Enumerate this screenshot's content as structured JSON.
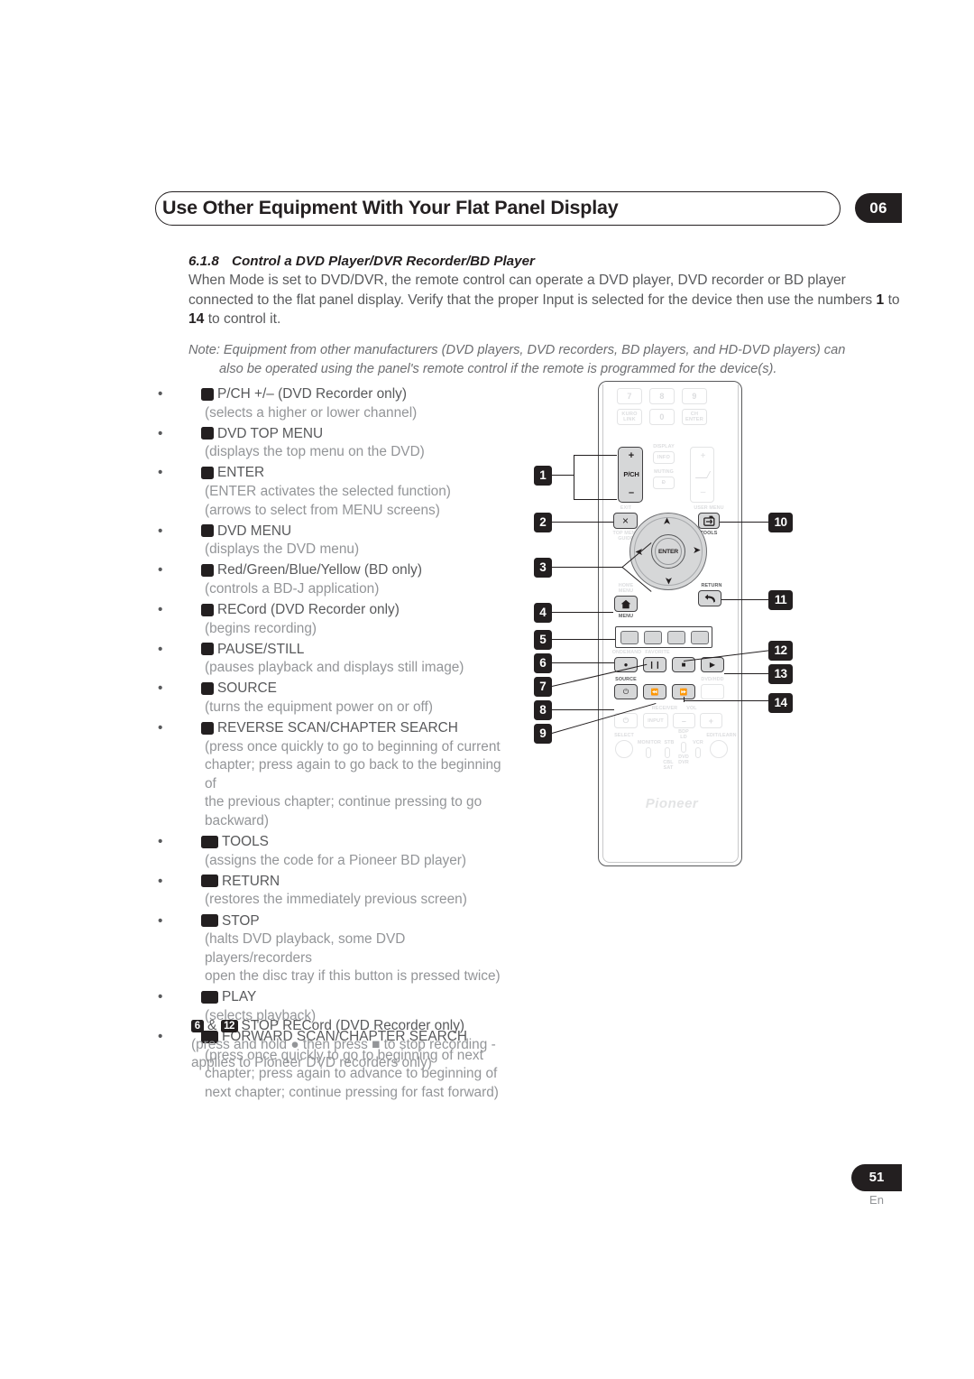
{
  "header": {
    "title": "Use Other Equipment With Your Flat Panel Display",
    "chapter_badge": "06"
  },
  "section": {
    "number": "6.1.8",
    "title": "Control a DVD Player/DVR Recorder/BD Player",
    "intro_part1": "When Mode is set to DVD/DVR, the remote control can operate a DVD player, DVD recorder or BD player connected to the flat panel display. Verify that the proper Input is selected for the device then use the numbers ",
    "intro_bold1": "1",
    "intro_part2": " to ",
    "intro_bold2": "14",
    "intro_part3": " to control it.",
    "note_line1": "Note: Equipment from other manufacturers (DVD players, DVD recorders, BD players, and HD-DVD players) can",
    "note_line2": "also be operated using the panel's remote control if the remote is programmed for the device(s)."
  },
  "items": [
    {
      "num": "1",
      "label": "P/CH +/– (DVD Recorder only)",
      "sub": [
        "(selects a higher or lower channel)"
      ]
    },
    {
      "num": "2",
      "label": "DVD TOP MENU",
      "sub": [
        "(displays the top menu on the DVD)"
      ]
    },
    {
      "num": "3",
      "label": "ENTER",
      "sub": [
        "(ENTER activates the selected function)",
        "(arrows to select from MENU screens)"
      ]
    },
    {
      "num": "4",
      "label": "DVD MENU",
      "sub": [
        "(displays the DVD menu)"
      ]
    },
    {
      "num": "5",
      "label": "Red/Green/Blue/Yellow (BD only)",
      "sub": [
        "(controls a BD-J application)"
      ]
    },
    {
      "num": "6",
      "label": "RECord (DVD Recorder only)",
      "sub": [
        "(begins recording)"
      ]
    },
    {
      "num": "7",
      "label": "PAUSE/STILL",
      "sub": [
        "(pauses playback and displays still image)"
      ]
    },
    {
      "num": "8",
      "label": "SOURCE",
      "sub": [
        "(turns the equipment power on or off)"
      ]
    },
    {
      "num": "9",
      "label": "REVERSE SCAN/CHAPTER SEARCH",
      "sub": [
        "(press once quickly to go to beginning of current",
        "chapter; press again to go back to the beginning of",
        "the previous chapter; continue pressing to go",
        "backward)"
      ]
    },
    {
      "num": "10",
      "label": "TOOLS",
      "sub": [
        "(assigns the code for a Pioneer BD player)"
      ]
    },
    {
      "num": "11",
      "label": "RETURN",
      "sub": [
        "(restores the immediately previous screen)"
      ]
    },
    {
      "num": "12",
      "label": "STOP",
      "sub": [
        "(halts DVD playback, some DVD players/recorders",
        "open the disc tray if this button is pressed twice)"
      ]
    },
    {
      "num": "13",
      "label": "PLAY",
      "sub": [
        "(selects playback)"
      ]
    },
    {
      "num": "14",
      "label": "FORWARD SCAN/CHAPTER SEARCH",
      "sub": [
        "(press once quickly to go to beginning of next",
        "chapter; press again to advance to beginning of",
        "next chapter; continue pressing for fast forward)"
      ]
    }
  ],
  "tail": {
    "num_a": "6",
    "amp": "&",
    "num_b": "12",
    "label": "STOP RECord (DVD Recorder only)",
    "sub1": "(press and hold ● then press ■ to stop recording -",
    "sub2": "applies to Pioneer DVD recorders only)"
  },
  "remote": {
    "keypad": [
      {
        "label": "7"
      },
      {
        "label": "8"
      },
      {
        "label": "9"
      },
      {
        "label": "KURO LINK"
      },
      {
        "label": "0"
      },
      {
        "label": "CH ENTER"
      }
    ],
    "pch": {
      "plus": "+",
      "label": "P/CH",
      "minus": "–"
    },
    "display_label": "DISPLAY",
    "display_key": "INFO",
    "muting_label": "MUTING",
    "muting_key": "Ð",
    "vol_plus": "+",
    "vol_minus": "–",
    "exit_label": "EXIT",
    "exit_key": "×",
    "topmenu_label_1": "TOP MENU",
    "topmenu_label_2": "GUIDE",
    "usermenu_label": "USER MENU",
    "tools_label": "TOOLS",
    "homemenu_label_1": "HOME",
    "homemenu_label_2": "MENU",
    "menu_label": "MENU",
    "return_label": "RETURN",
    "enter_label": "ENTER",
    "ondemand_label": "ONDEMAND",
    "favorite_label": "FAVORITE",
    "source_label": "SOURCE",
    "dvdhdd_label": "DVD/HDD",
    "receiver_label": "RECEIVER",
    "receiver_input": "INPUT",
    "vol_label": "VOL",
    "select_label": "SELECT",
    "monitor_label": "MONITOR",
    "stb_label": "STB",
    "cbl_label_1": "CBL",
    "cbl_label_2": "SAT",
    "bdp_label_1": "BDP",
    "bdp_label_2": "LD",
    "dvd_label_1": "DVD",
    "dvd_label_2": "DVR",
    "vcr_label": "VCR",
    "edit_learn_label": "EDIT/LEARN",
    "brand": "Pioneer",
    "transport": {
      "record": "●",
      "pause": "❙❙",
      "stop": "■",
      "play": "▶",
      "power": "⏻",
      "skip_back": "⏪",
      "skip_fwd": "⏩"
    },
    "callouts_left": [
      "1",
      "2",
      "3",
      "4",
      "5",
      "6",
      "7",
      "8",
      "9"
    ],
    "callouts_right": [
      "10",
      "11",
      "12",
      "13",
      "14"
    ]
  },
  "footer": {
    "page": "51",
    "lang": "En"
  },
  "colors": {
    "ink": "#231f20",
    "body": "#58595b",
    "muted": "#939598",
    "faint": "#dcdddf"
  }
}
